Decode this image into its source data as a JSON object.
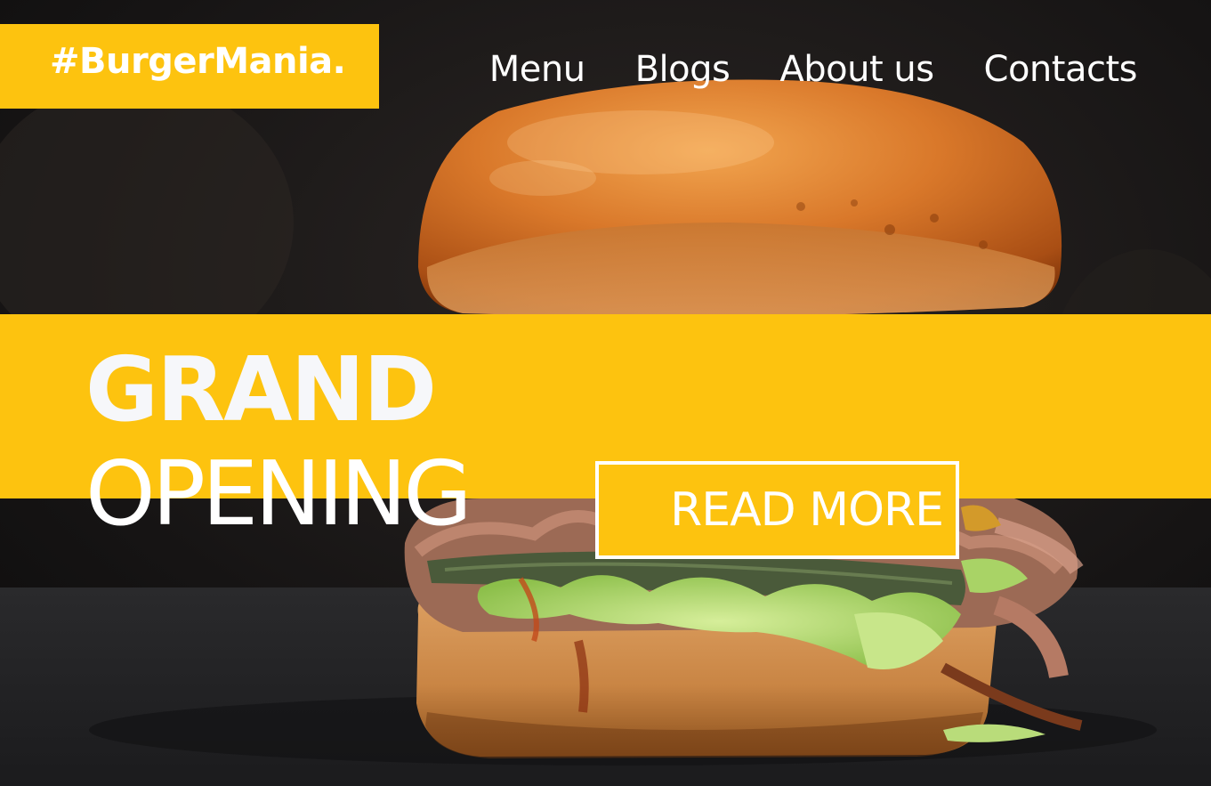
{
  "brand": {
    "logo_text": "#BurgerMania.",
    "accent_color": "#fdc30f"
  },
  "nav": {
    "items": [
      {
        "label": "Menu"
      },
      {
        "label": "Blogs"
      },
      {
        "label": "About us"
      },
      {
        "label": "Contacts"
      }
    ]
  },
  "hero": {
    "headline_line1": "GRAND",
    "headline_line2": "OPENING",
    "cta_label": "READ MORE",
    "background_image": "burger-photo"
  }
}
